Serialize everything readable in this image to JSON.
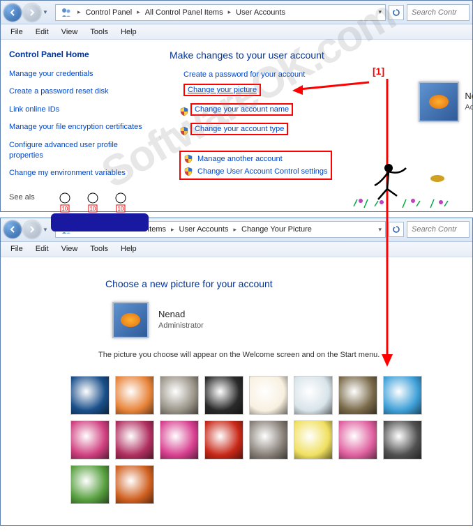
{
  "annotations": {
    "marker1": "[1]",
    "watermark": "SoftwareOK.com"
  },
  "window1": {
    "breadcrumb": [
      "Control Panel",
      "All Control Panel Items",
      "User Accounts"
    ],
    "search_placeholder": "Search Contr",
    "menu": {
      "file": "File",
      "edit": "Edit",
      "view": "View",
      "tools": "Tools",
      "help": "Help"
    },
    "sidebar": {
      "home": "Control Panel Home",
      "links": [
        "Manage your credentials",
        "Create a password reset disk",
        "Link online IDs",
        "Manage your file encryption certificates",
        "Configure advanced user profile properties",
        "Change my environment variables"
      ],
      "see_also": "See als"
    },
    "main": {
      "heading": "Make changes to your user account",
      "actions": {
        "create_password": "Create a password for your account",
        "change_picture": "Change your picture",
        "change_name": "Change your account name",
        "change_type": "Change your account type",
        "manage_another": "Manage another account",
        "change_uac": "Change User Account Control settings"
      }
    },
    "user": {
      "name": "Ne",
      "role": "Ad"
    }
  },
  "window2": {
    "breadcrumb": [
      "All Control Panel Items",
      "User Accounts",
      "Change Your Picture"
    ],
    "breadcrumb_prefix": "«",
    "search_placeholder": "Search Contr",
    "menu": {
      "file": "File",
      "edit": "Edit",
      "view": "View",
      "tools": "Tools",
      "help": "Help"
    },
    "heading": "Choose a new picture for your account",
    "user": {
      "name": "Nenad",
      "role": "Administrator"
    },
    "description": "The picture you choose will appear on the Welcome screen and on the Start menu.",
    "picture_options": [
      "swirl-blue",
      "starfish",
      "koala",
      "vinyl",
      "maneki-neko",
      "gyro",
      "kitten",
      "butterfly",
      "paint-swirl",
      "beachball",
      "tulips",
      "tomatoes",
      "dog-bw",
      "crayons",
      "flower-pink",
      "jacks",
      "leaf",
      "swirl-multi"
    ],
    "picture_colors": [
      "#1a4f8a",
      "#e8843a",
      "#9a9488",
      "#2a2a2a",
      "#f8f0e0",
      "#d8e4ea",
      "#7a6a4a",
      "#3fa0d8",
      "#d04080",
      "#b03060",
      "#d84090",
      "#c82818",
      "#888078",
      "#f0e060",
      "#e060a0",
      "#505050",
      "#58a040",
      "#d06020"
    ]
  }
}
